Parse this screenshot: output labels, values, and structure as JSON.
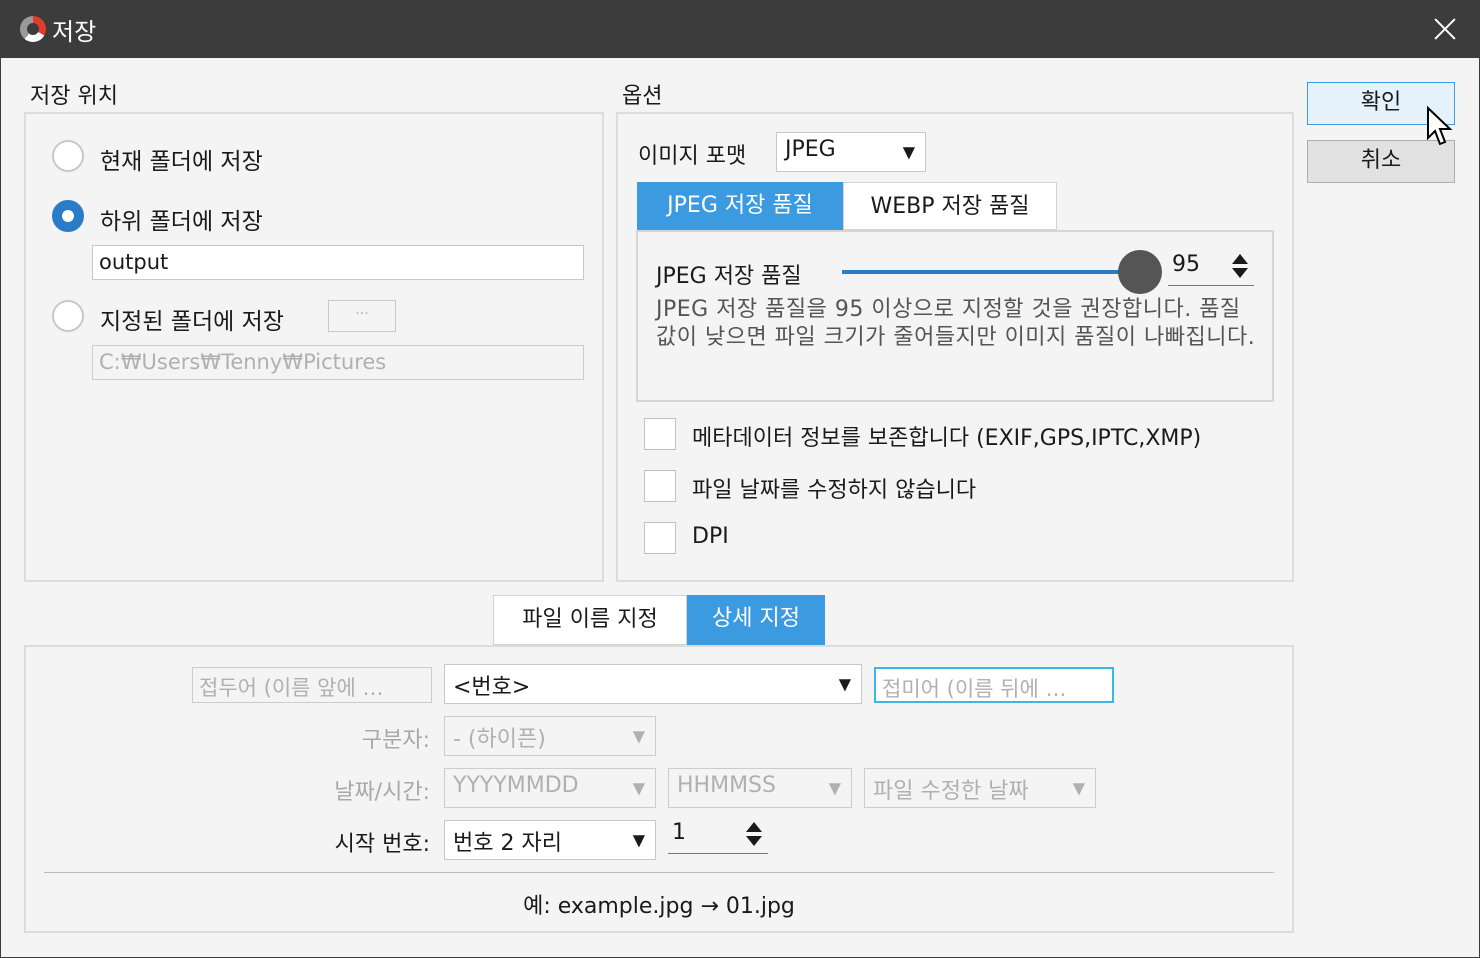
{
  "window": {
    "title": "저장",
    "close_icon": "close-icon",
    "logo_icon": "app-logo-icon"
  },
  "location": {
    "group_label": "저장 위치",
    "options": [
      {
        "label": "현재 폴더에 저장",
        "checked": false
      },
      {
        "label": "하위 폴더에 저장",
        "checked": true
      },
      {
        "label": "지정된 폴더에 저장",
        "checked": false
      }
    ],
    "subfolder_value": "output",
    "browse_label": "···",
    "path_value": "C:₩Users₩Tenny₩Pictures"
  },
  "options": {
    "group_label": "옵션",
    "format_label": "이미지 포맷",
    "format_value": "JPEG",
    "tabs": [
      "JPEG 저장 품질",
      "WEBP 저장 품질"
    ],
    "quality_label": "JPEG 저장 품질",
    "quality_value": "95",
    "quality_fraction": 0.95,
    "quality_desc": "JPEG 저장 품질을 95 이상으로 지정할 것을 권장합니다. 품질 값이 낮으면 파일 크기가 줄어들지만 이미지 품질이 나빠집니다.",
    "checkboxes": [
      {
        "label": "메타데이터 정보를 보존합니다 (EXIF,GPS,IPTC,XMP)",
        "checked": false
      },
      {
        "label": "파일 날짜를 수정하지 않습니다",
        "checked": false
      },
      {
        "label": "DPI",
        "checked": false
      }
    ]
  },
  "buttons": {
    "ok": "확인",
    "cancel": "취소"
  },
  "naming": {
    "tabs": [
      "파일 이름 지정",
      "상세 지정"
    ],
    "prefix_placeholder": "접두어 (이름 앞에 …",
    "number_combo": "<번호>",
    "suffix_placeholder": "접미어 (이름 뒤에 …",
    "separator_label": "구분자:",
    "separator_value": "- (하이픈)",
    "datetime_label": "날짜/시간:",
    "date_value": "YYYYMMDD",
    "time_value": "HHMMSS",
    "date_source_value": "파일 수정한 날짜",
    "start_label": "시작 번호:",
    "digits_value": "번호 2 자리",
    "start_value": "1",
    "example": "예: example.jpg → 01.jpg"
  },
  "colors": {
    "accent": "#3c9ae0",
    "titlebar": "#3c3c3c"
  }
}
